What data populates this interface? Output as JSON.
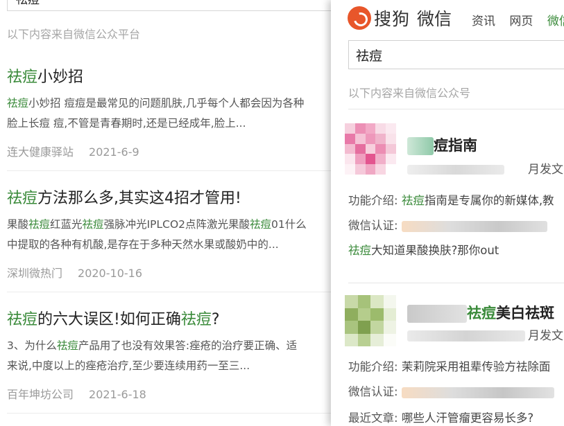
{
  "left": {
    "search_value": "祛痘",
    "source_note": "以下内容来自微信公众平台",
    "results": [
      {
        "title_hl": "祛痘",
        "title_rest": "小妙招",
        "snippet1_a": "祛痘",
        "snippet1_b": "小妙招 痘痘是最常见的问题肌肤,几乎每个人都会因为各种",
        "snippet2": "脸上长痘 痘,不管是青春期时,还是已经成年,脸上...",
        "source": "连大健康驿站",
        "date": "2021-6-9"
      },
      {
        "title_hl": "祛痘",
        "title_rest": "方法那么多,其实这4招才管用!",
        "snippet1_a": "果酸",
        "snippet1_b": "祛痘",
        "snippet1_c": "红蓝光",
        "snippet1_d": "祛痘",
        "snippet1_e": "强脉冲光IPLCO2点阵激光果酸",
        "snippet1_f": "祛痘",
        "snippet1_g": "01什么",
        "snippet2": "中提取的各种有机酸,是存在于多种天然水果或酸奶中的...",
        "source": "深圳微热门",
        "date": "2020-10-16"
      },
      {
        "title_hl": "祛痘",
        "title_mid": "的六大误区!如何正确",
        "title_hl2": "祛痘",
        "title_end": "?",
        "snippet1_a": "3、为什么",
        "snippet1_b": "祛痘",
        "snippet1_c": "产品用了也没有效果答:痤疮的治疗要正确、适",
        "snippet2": "来说,中度以上的痤疮治疗,至少要连续用药一至三...",
        "source": "百年坤坊公司",
        "date": "2021-6-18"
      }
    ]
  },
  "right": {
    "logo_text": "搜狗",
    "logo_sub": "微信",
    "nav": [
      "资讯",
      "网页",
      "微信"
    ],
    "search_value": "祛痘",
    "note": "以下内容来自微信公众号",
    "accounts": [
      {
        "name": "痘指南",
        "meta": "月发文",
        "intro_label": "功能介绍:",
        "intro_hl": "祛痘",
        "intro_text": "指南是专属你的新媒体,教",
        "cert_label": "微信认证:",
        "recent_hl": "祛痘",
        "recent_text": "大知道果酸换肤?那你out"
      },
      {
        "name_hl": "祛痘",
        "name_rest": "美白祛斑",
        "meta": "月发文",
        "intro_label": "功能介绍:",
        "intro_text": "茉莉院采用祖辈传验方祛除面",
        "cert_label": "微信认证:",
        "recent_label": "最近文章:",
        "recent_text": "哪些人汗管瘤更容易长多?"
      }
    ]
  },
  "colors": {
    "highlight": "#3a8a3a",
    "logo": "#e8562a"
  }
}
